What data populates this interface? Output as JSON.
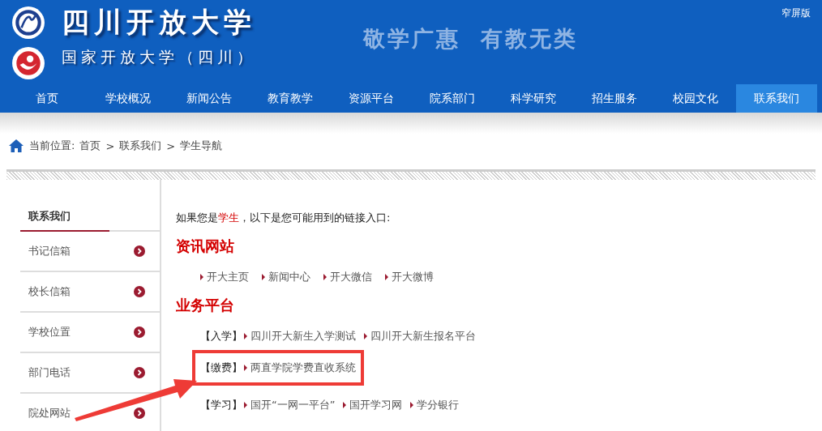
{
  "header": {
    "title": "四川开放大学",
    "subtitle": "国家开放大学（四川）",
    "slogan": "敬学广惠  有教无类",
    "narrow_link": "窄屏版"
  },
  "nav": [
    {
      "label": "首页",
      "selected": false
    },
    {
      "label": "学校概况",
      "selected": false
    },
    {
      "label": "新闻公告",
      "selected": false
    },
    {
      "label": "教育教学",
      "selected": false
    },
    {
      "label": "资源平台",
      "selected": false
    },
    {
      "label": "院系部门",
      "selected": false
    },
    {
      "label": "科学研究",
      "selected": false
    },
    {
      "label": "招生服务",
      "selected": false
    },
    {
      "label": "校园文化",
      "selected": false
    },
    {
      "label": "联系我们",
      "selected": true
    }
  ],
  "breadcrumb": {
    "label": "当前位置:",
    "items": [
      "首页",
      "联系我们",
      "学生导航"
    ],
    "separators": [
      ">",
      ">"
    ]
  },
  "sidebar": {
    "heading": "联系我们",
    "items": [
      "书记信箱",
      "校长信箱",
      "学校位置",
      "部门电话",
      "院处网站"
    ]
  },
  "content": {
    "intro": "如果您是**学生**，以下是您可能用到的链接入口:",
    "sections": [
      {
        "title": "资讯网站",
        "rows": [
          {
            "links": [
              "开大主页",
              "新闻中心",
              "开大微信",
              "开大微博"
            ],
            "highlighted": false
          }
        ]
      },
      {
        "title": "业务平台",
        "rows": [
          {
            "tag": "【入学】",
            "links": [
              "四川开大新生入学测试",
              "四川开大新生报名平台"
            ],
            "highlighted": false
          },
          {
            "tag": "【缴费】",
            "links": [
              "两直学院学费直收系统"
            ],
            "highlighted": true
          },
          {
            "tag": "【学习】",
            "links": [
              "国开“一网一平台”",
              "国开学习网",
              "学分银行"
            ],
            "highlighted": false
          }
        ]
      }
    ]
  }
}
